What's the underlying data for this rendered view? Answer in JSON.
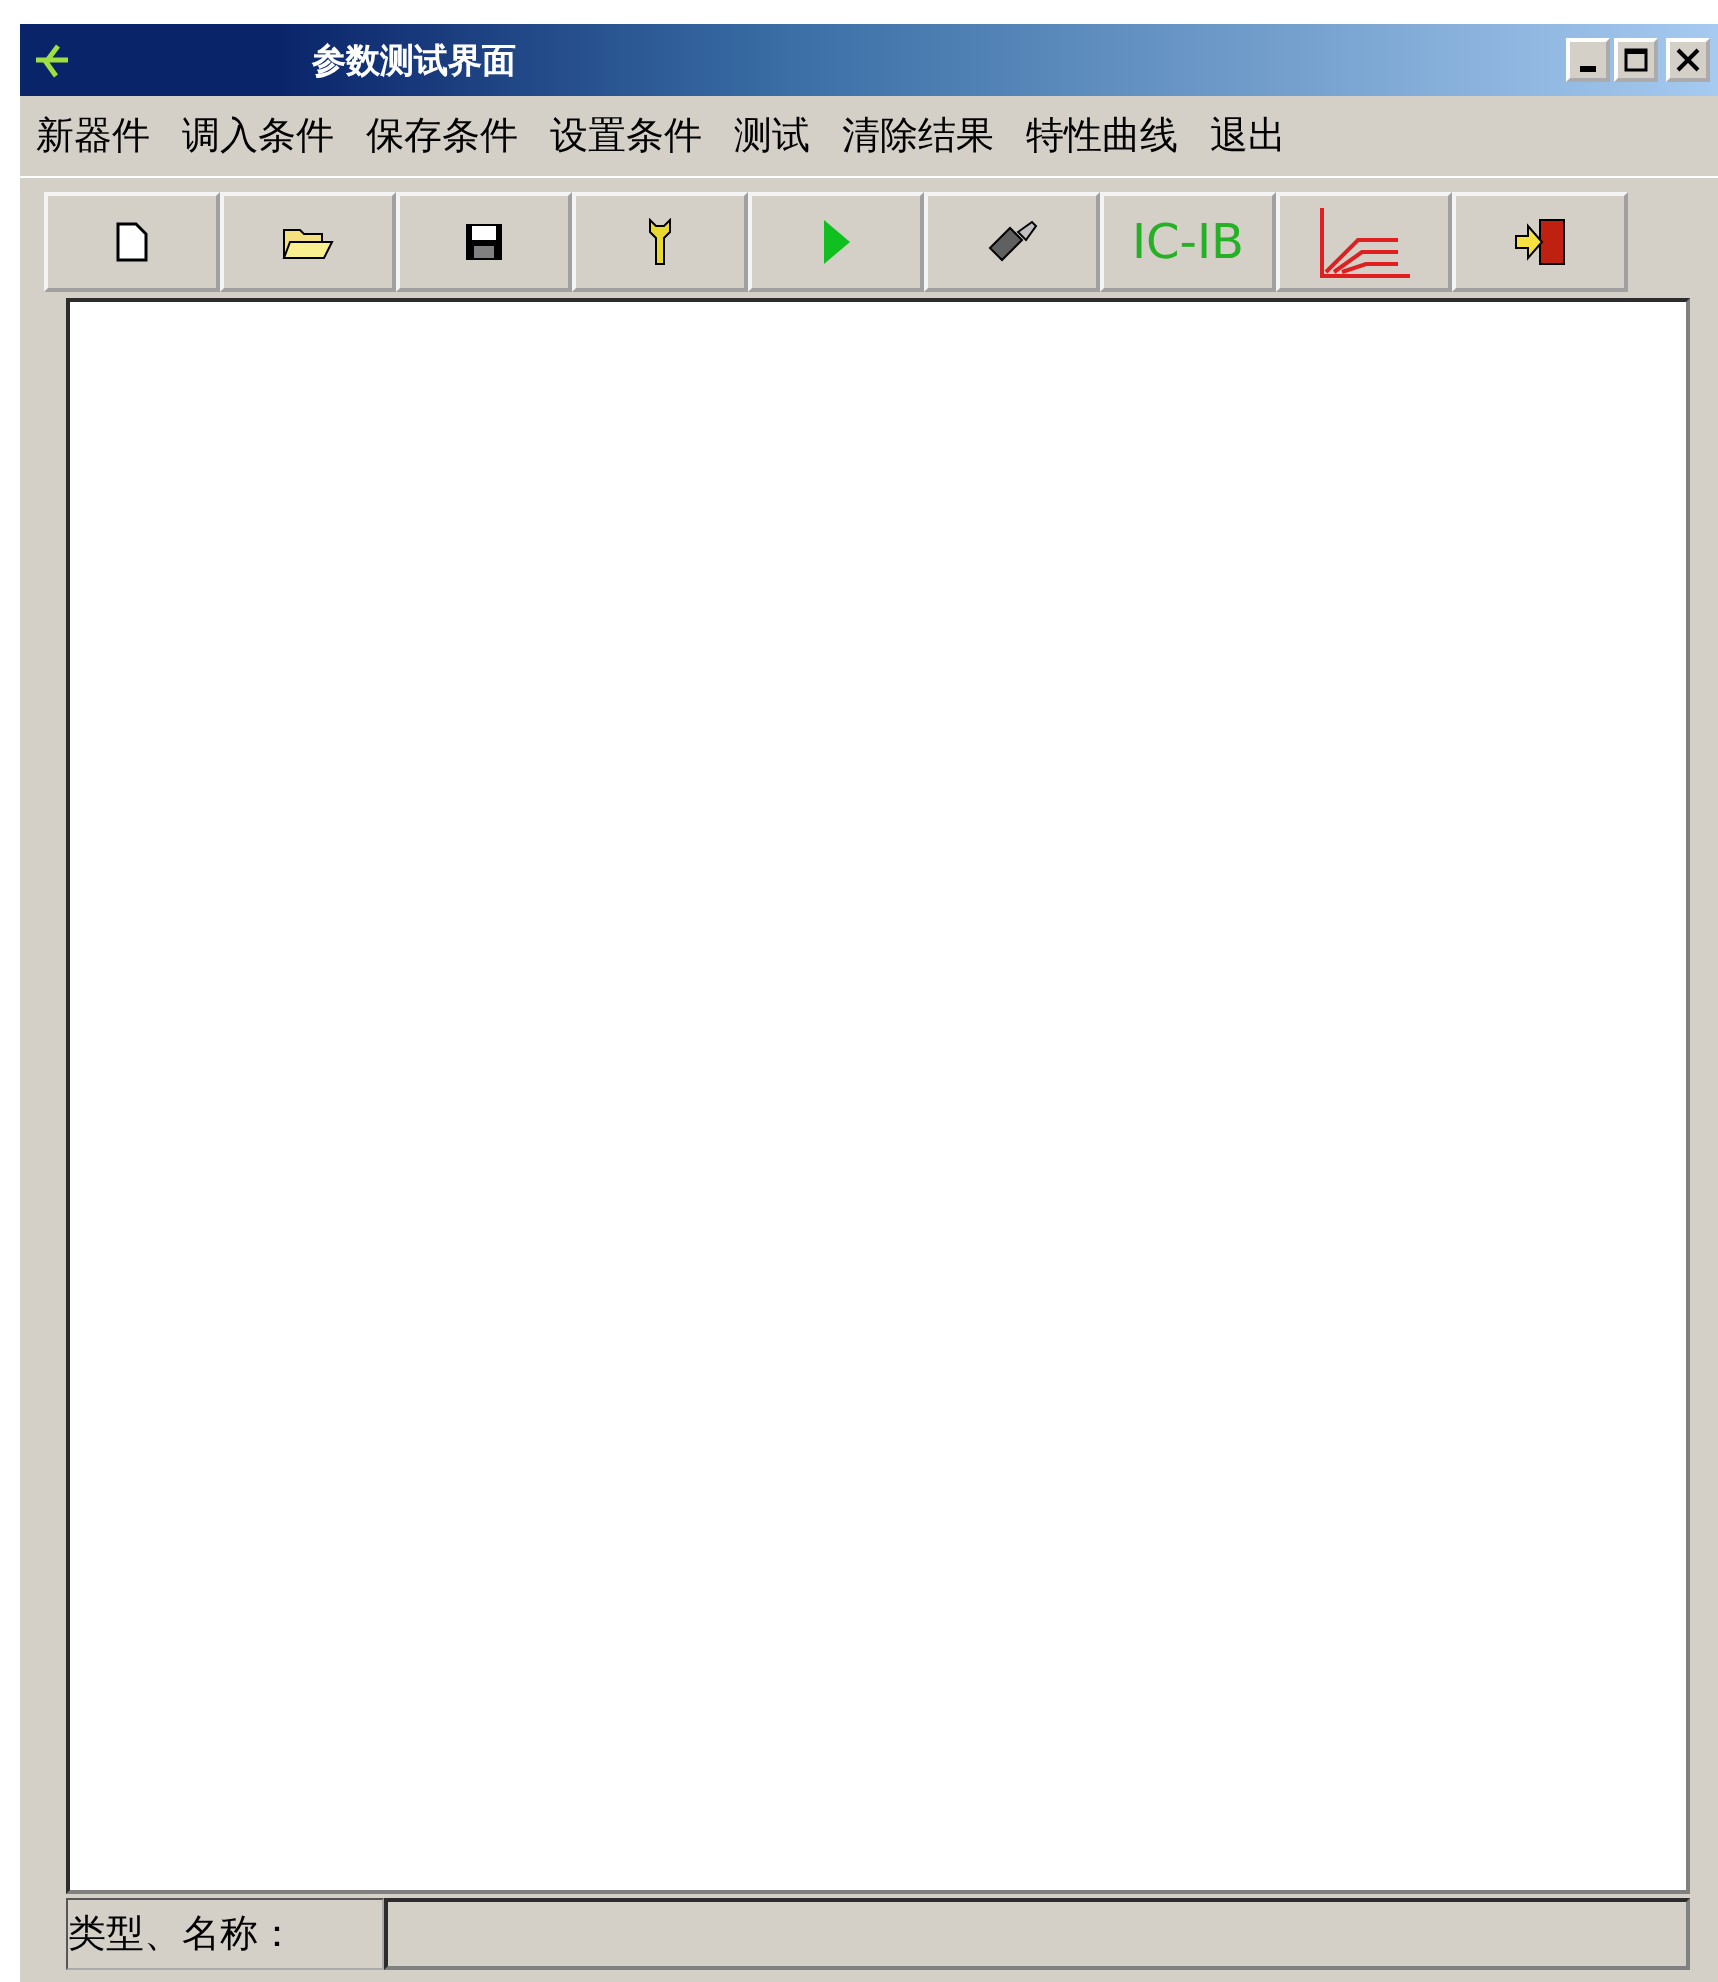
{
  "window": {
    "title": "参数测试界面"
  },
  "menu": [
    {
      "label": "新器件"
    },
    {
      "label": "调入条件"
    },
    {
      "label": "保存条件"
    },
    {
      "label": "设置条件"
    },
    {
      "label": "测试"
    },
    {
      "label": "清除结果"
    },
    {
      "label": "特性曲线"
    },
    {
      "label": "退出"
    }
  ],
  "toolbar": [
    {
      "kind": "new"
    },
    {
      "kind": "open"
    },
    {
      "kind": "save"
    },
    {
      "kind": "tool"
    },
    {
      "kind": "run"
    },
    {
      "kind": "brush"
    },
    {
      "kind": "text",
      "label": "IC-IB"
    },
    {
      "kind": "curve"
    },
    {
      "kind": "exit"
    }
  ],
  "status_bar": {
    "label": "类型、名称："
  }
}
